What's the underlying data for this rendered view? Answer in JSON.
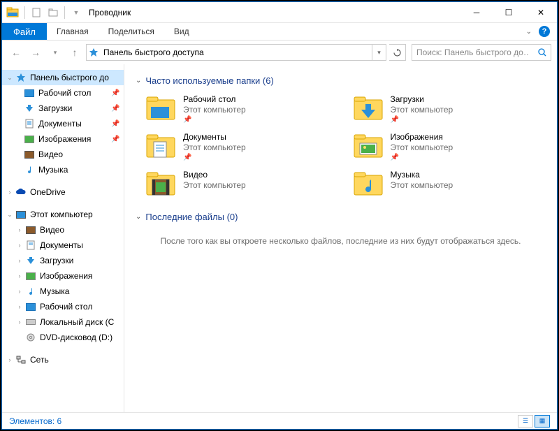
{
  "titlebar": {
    "title": "Проводник"
  },
  "ribbon": {
    "tabs": {
      "file": "Файл",
      "home": "Главная",
      "share": "Поделиться",
      "view": "Вид"
    }
  },
  "address": {
    "path": "Панель быстрого доступа"
  },
  "search": {
    "placeholder": "Поиск: Панель быстрого до…"
  },
  "tree": {
    "quick": "Панель быстрого до",
    "desktop": "Рабочий стол",
    "downloads": "Загрузки",
    "documents": "Документы",
    "pictures": "Изображения",
    "videos": "Видео",
    "music": "Музыка",
    "onedrive": "OneDrive",
    "thispc": "Этот компьютер",
    "pc_videos": "Видео",
    "pc_documents": "Документы",
    "pc_downloads": "Загрузки",
    "pc_pictures": "Изображения",
    "pc_music": "Музыка",
    "pc_desktop": "Рабочий стол",
    "pc_localdisk": "Локальный диск (C",
    "pc_dvd": "DVD-дисковод (D:)",
    "network": "Сеть"
  },
  "content": {
    "group_frequent": "Часто используемые папки (6)",
    "group_recent": "Последние файлы (0)",
    "subtext": "Этот компьютер",
    "folders": {
      "desktop": "Рабочий стол",
      "downloads": "Загрузки",
      "documents": "Документы",
      "pictures": "Изображения",
      "videos": "Видео",
      "music": "Музыка"
    },
    "empty": "После того как вы откроете несколько файлов, последние из них будут отображаться здесь."
  },
  "statusbar": {
    "items": "Элементов: 6"
  }
}
